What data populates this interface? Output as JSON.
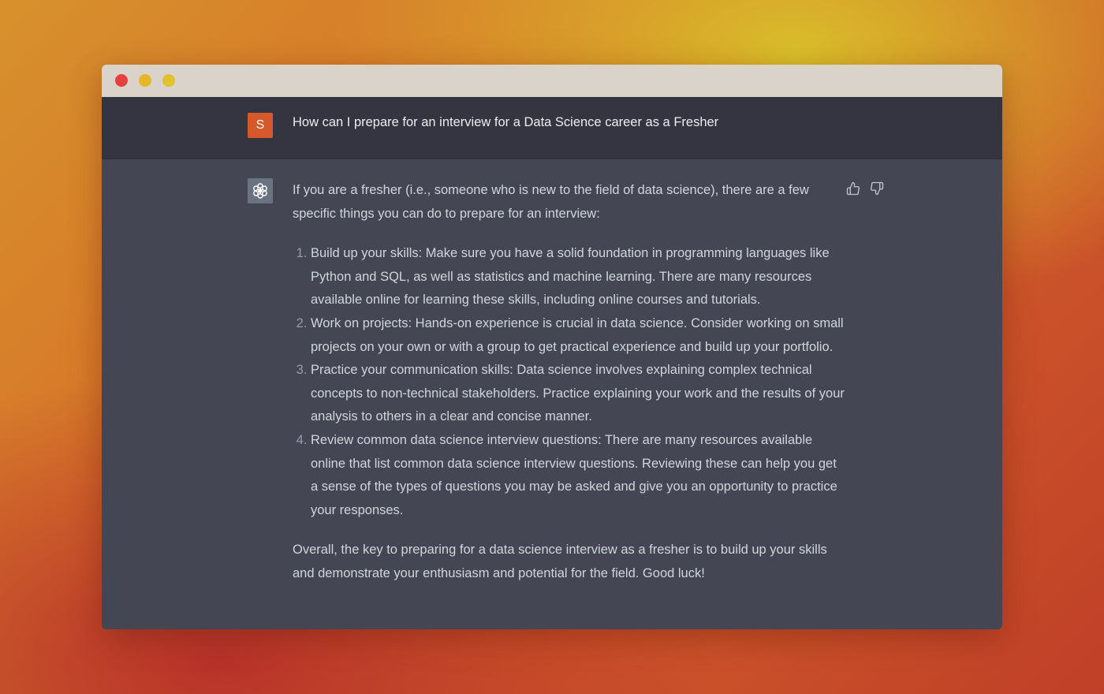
{
  "colors": {
    "user_avatar": "#d6592b",
    "user_row_bg": "#343541",
    "bot_row_bg": "#444654",
    "text": "#d1d5db"
  },
  "window": {
    "controls": [
      "close",
      "minimize",
      "maximize"
    ]
  },
  "user_message": {
    "avatar_initial": "S",
    "text": "How can I prepare for an interview for a Data Science career as a Fresher"
  },
  "assistant_message": {
    "avatar_icon": "openai-logo-icon",
    "intro": "If you are a fresher (i.e., someone who is new to the field of data science), there are a few specific things you can do to prepare for an interview:",
    "items": [
      "Build up your skills: Make sure you have a solid foundation in programming languages like Python and SQL, as well as statistics and machine learning. There are many resources available online for learning these skills, including online courses and tutorials.",
      "Work on projects: Hands-on experience is crucial in data science. Consider working on small projects on your own or with a group to get practical experience and build up your portfolio.",
      "Practice your communication skills: Data science involves explaining complex technical concepts to non-technical stakeholders. Practice explaining your work and the results of your analysis to others in a clear and concise manner.",
      "Review common data science interview questions: There are many resources available online that list common data science interview questions. Reviewing these can help you get a sense of the types of questions you may be asked and give you an opportunity to practice your responses."
    ],
    "outro": "Overall, the key to preparing for a data science interview as a fresher is to build up your skills and demonstrate your enthusiasm and potential for the field. Good luck!"
  },
  "feedback": {
    "up_icon": "thumbs-up-icon",
    "down_icon": "thumbs-down-icon"
  }
}
